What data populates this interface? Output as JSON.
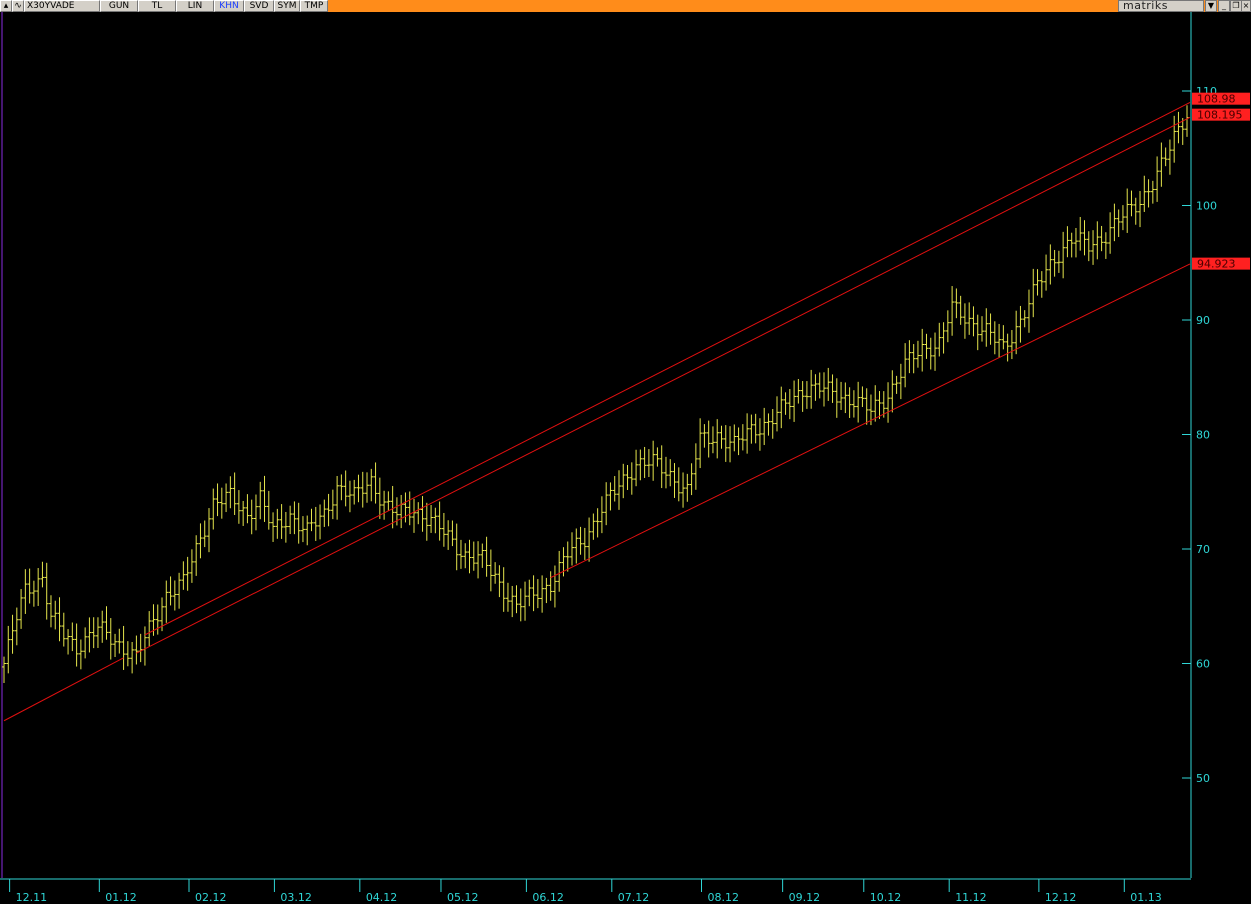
{
  "toolbar": {
    "symbol": "X30YVADE",
    "buttons": [
      "GUN",
      "TL",
      "LIN",
      "KHN",
      "SVD",
      "SYM",
      "TMP"
    ],
    "active_button": "KHN",
    "brand": "matriks",
    "icons": [
      "chart-menu-icon",
      "dropdown-icon",
      "minimize-icon",
      "restore-icon",
      "close-icon"
    ]
  },
  "chart_data": {
    "type": "ohlc",
    "colors": {
      "bars": "#e6e64d",
      "trendlines": "#e01010",
      "axis": "#2fd6d6",
      "background": "#000000",
      "price_tag": "#ff2020"
    },
    "ylim": [
      41,
      119
    ],
    "yticks": [
      50,
      60,
      70,
      80,
      90,
      100,
      110
    ],
    "x_tick_labels": [
      "12.11",
      "01.12",
      "02.12",
      "03.12",
      "04.12",
      "05.12",
      "06.12",
      "07.12",
      "08.12",
      "09.12",
      "10.12",
      "11.12",
      "12.12",
      "01.13"
    ],
    "x_tick_index": [
      6,
      27,
      48,
      68,
      88,
      107,
      127,
      147,
      168,
      187,
      206,
      226,
      247,
      267
    ],
    "bar_count": 278,
    "closes_anchor": [
      [
        0,
        60
      ],
      [
        3,
        64
      ],
      [
        5,
        66.5
      ],
      [
        9,
        67.5
      ],
      [
        11,
        64
      ],
      [
        14,
        62.5
      ],
      [
        17,
        61.5
      ],
      [
        22,
        63
      ],
      [
        26,
        62
      ],
      [
        31,
        60.5
      ],
      [
        34,
        63
      ],
      [
        38,
        66
      ],
      [
        42,
        67
      ],
      [
        45,
        70
      ],
      [
        49,
        74
      ],
      [
        53,
        74.5
      ],
      [
        57,
        73
      ],
      [
        60,
        74.5
      ],
      [
        63,
        71.5
      ],
      [
        67,
        73
      ],
      [
        71,
        71.5
      ],
      [
        75,
        73
      ],
      [
        78,
        75.5
      ],
      [
        82,
        74.5
      ],
      [
        86,
        76
      ],
      [
        89,
        74
      ],
      [
        92,
        73
      ],
      [
        96,
        73.5
      ],
      [
        100,
        72.5
      ],
      [
        104,
        71
      ],
      [
        108,
        69.5
      ],
      [
        112,
        69
      ],
      [
        116,
        67
      ],
      [
        120,
        65
      ],
      [
        124,
        66
      ],
      [
        128,
        67
      ],
      [
        132,
        69.5
      ],
      [
        136,
        71
      ],
      [
        140,
        73.5
      ],
      [
        144,
        75.5
      ],
      [
        148,
        77.5
      ],
      [
        152,
        77.5
      ],
      [
        156,
        76.5
      ],
      [
        160,
        75
      ],
      [
        163,
        79.5
      ],
      [
        167,
        80
      ],
      [
        171,
        79
      ],
      [
        175,
        80.5
      ],
      [
        179,
        81
      ],
      [
        183,
        82.5
      ],
      [
        187,
        84
      ],
      [
        191,
        84
      ],
      [
        195,
        83.5
      ],
      [
        199,
        83
      ],
      [
        203,
        82
      ],
      [
        207,
        83.5
      ],
      [
        211,
        86
      ],
      [
        215,
        87.5
      ],
      [
        219,
        88
      ],
      [
        222,
        91
      ],
      [
        226,
        90
      ],
      [
        230,
        89
      ],
      [
        234,
        87.5
      ],
      [
        238,
        90
      ],
      [
        242,
        93
      ],
      [
        246,
        95.5
      ],
      [
        250,
        97
      ],
      [
        254,
        96.5
      ],
      [
        258,
        97.5
      ],
      [
        262,
        99
      ],
      [
        266,
        100.5
      ],
      [
        269,
        102
      ],
      [
        272,
        104
      ],
      [
        274,
        106
      ],
      [
        277,
        108.2
      ]
    ],
    "trendlines": [
      {
        "name": "upper-channel-line",
        "x0": 33,
        "y0": 62.5,
        "x1": 280,
        "y1": 109.0
      },
      {
        "name": "middle-channel-line",
        "x0": 31,
        "y0": 60.9,
        "x1": 280,
        "y1": 107.7
      },
      {
        "name": "lower-trendline",
        "x0": 0,
        "y0": 55.0,
        "x1": 28,
        "y1": 60.5
      },
      {
        "name": "lower-channel-line",
        "x0": 128,
        "y0": 67.5,
        "x1": 280,
        "y1": 94.9
      }
    ],
    "price_tags": [
      {
        "label": "108.98",
        "value": 108.98
      },
      {
        "label": "108.195",
        "value": 108.195
      },
      {
        "label": "94.923",
        "value": 94.923
      }
    ]
  }
}
